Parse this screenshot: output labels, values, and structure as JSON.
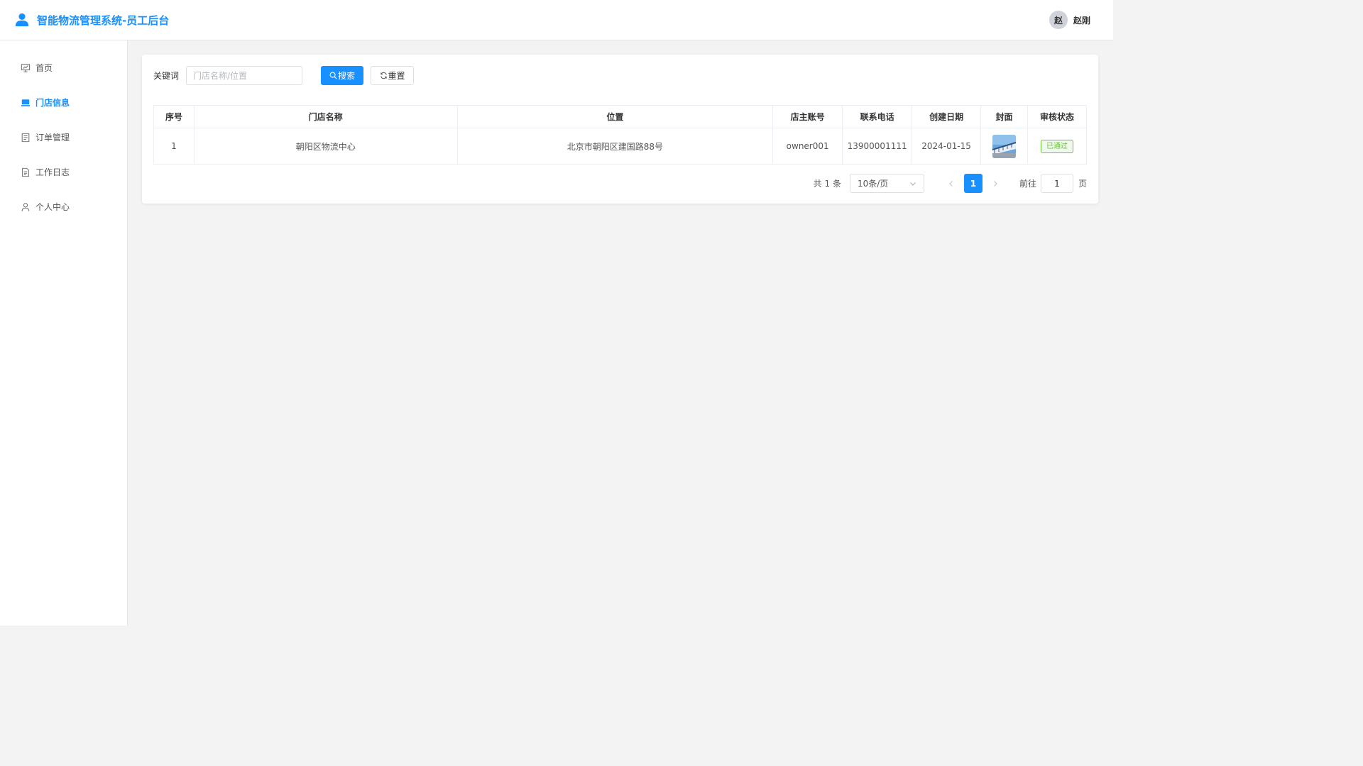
{
  "header": {
    "title": "智能物流管理系统-员工后台",
    "user_avatar_text": "赵",
    "user_name": "赵刚"
  },
  "sidebar": {
    "items": [
      {
        "label": "首页",
        "icon": "chart-icon",
        "active": false
      },
      {
        "label": "门店信息",
        "icon": "store-icon",
        "active": true
      },
      {
        "label": "订单管理",
        "icon": "document-icon",
        "active": false
      },
      {
        "label": "工作日志",
        "icon": "file-icon",
        "active": false
      },
      {
        "label": "个人中心",
        "icon": "user-icon",
        "active": false
      }
    ]
  },
  "search": {
    "label": "关键词",
    "placeholder": "门店名称/位置",
    "value": "",
    "search_button": "搜索",
    "reset_button": "重置"
  },
  "table": {
    "columns": [
      "序号",
      "门店名称",
      "位置",
      "店主账号",
      "联系电话",
      "创建日期",
      "封面",
      "审核状态"
    ],
    "rows": [
      {
        "index": "1",
        "name": "朝阳区物流中心",
        "location": "北京市朝阳区建国路88号",
        "owner": "owner001",
        "phone": "13900001111",
        "created": "2024-01-15",
        "cover": "store-cover-image",
        "status": "已通过"
      }
    ]
  },
  "pagination": {
    "total_text": "共 1 条",
    "page_size": "10条/页",
    "current_page": "1",
    "goto_label": "前往",
    "goto_value": "1",
    "page_suffix": "页"
  },
  "colors": {
    "primary": "#1890ff",
    "success": "#67c23a",
    "background": "#f3f3f3"
  }
}
